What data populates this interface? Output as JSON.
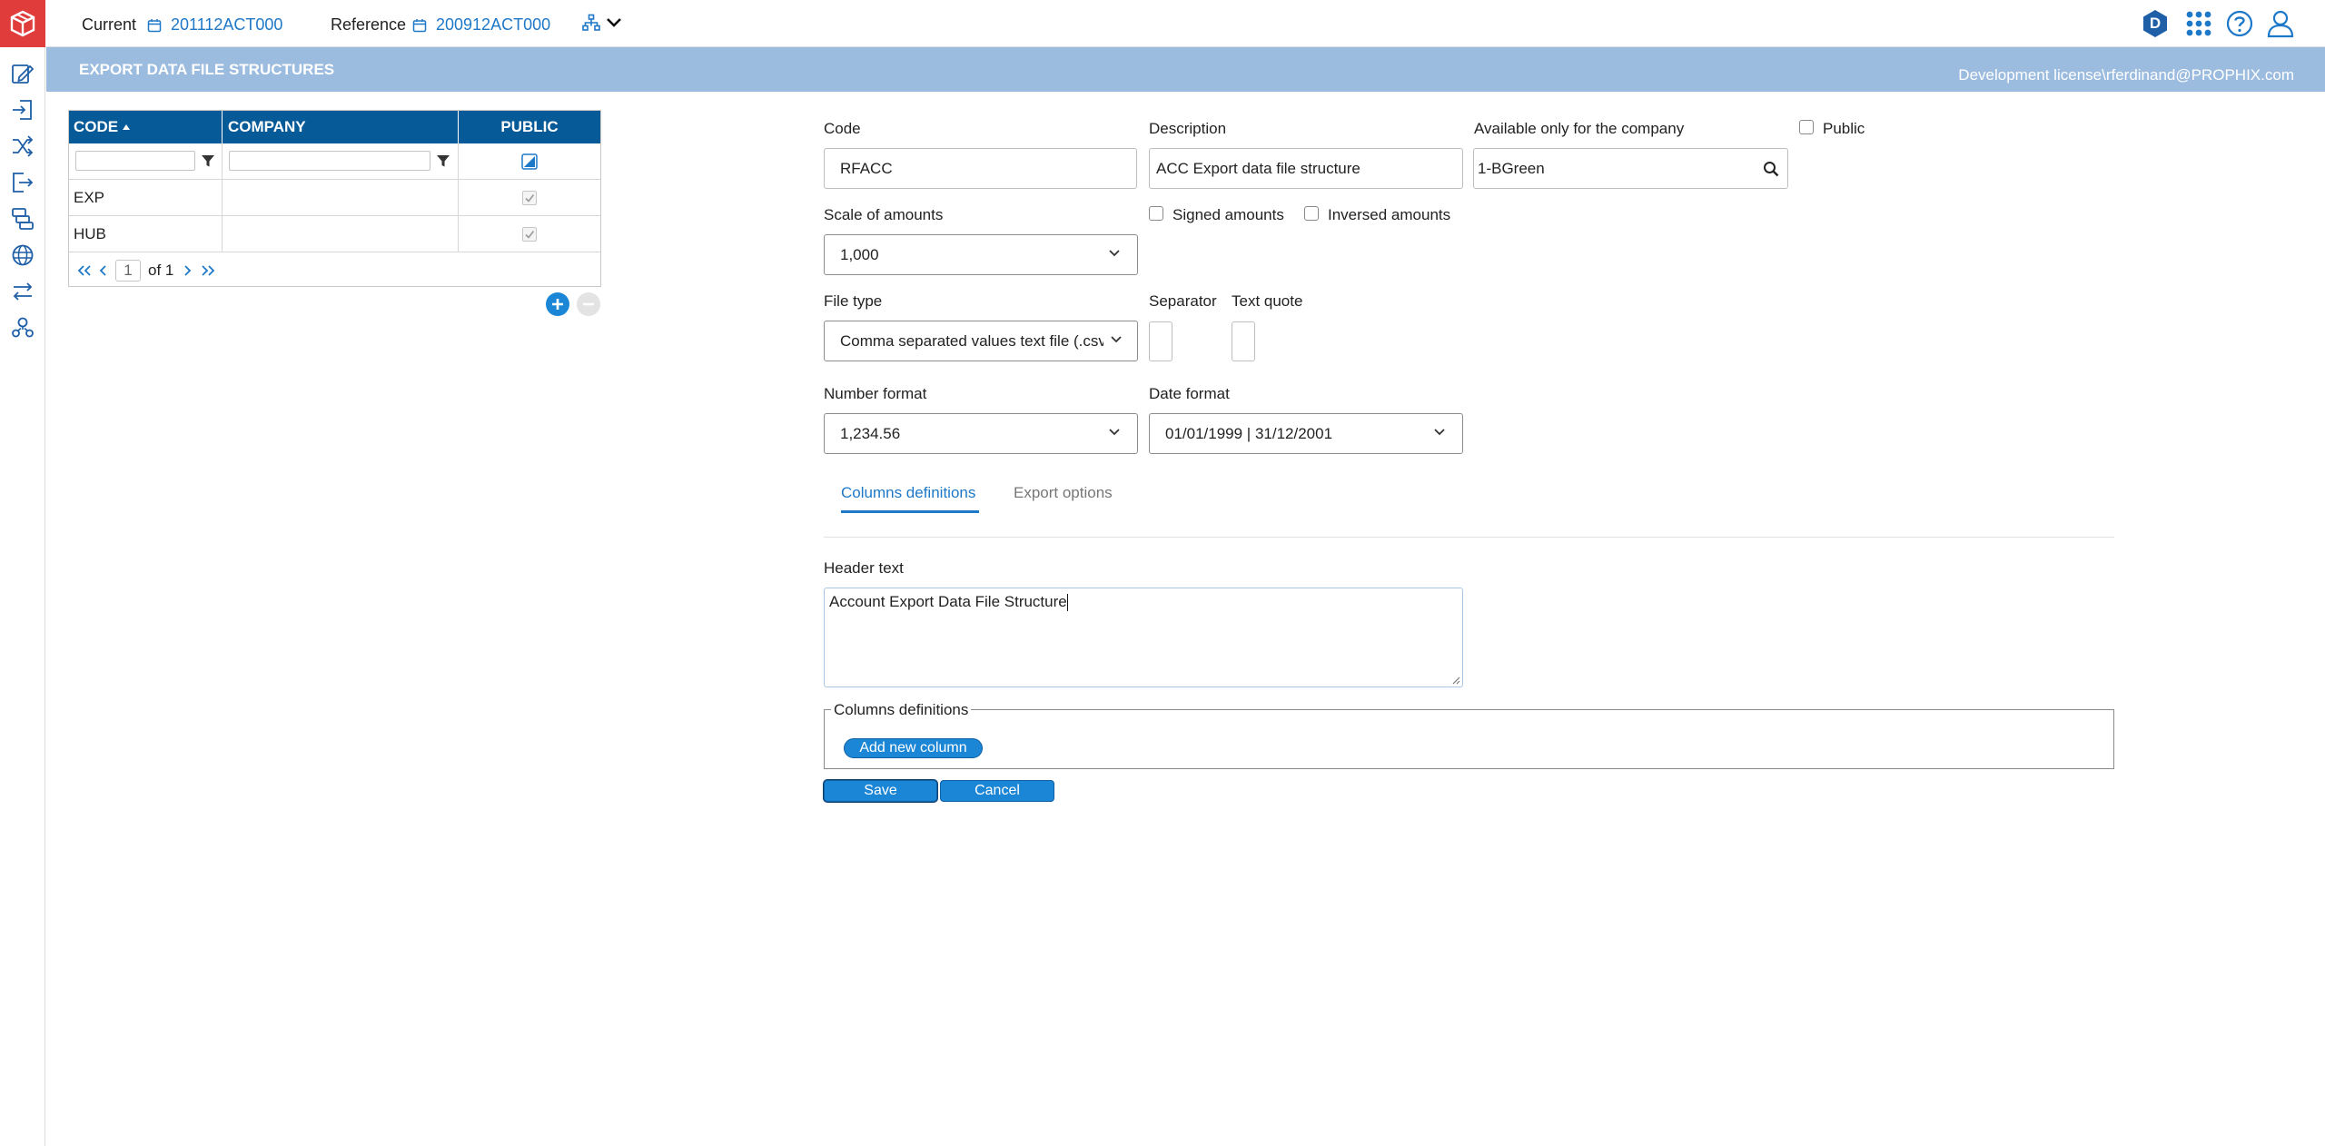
{
  "topbar": {
    "current_label": "Current",
    "current_value": "201112ACT000",
    "reference_label": "Reference",
    "reference_value": "200912ACT000",
    "avatar_letter": "D",
    "icons": [
      "app-logo-icon",
      "calendar-icon",
      "hierarchy-icon",
      "chevron-down-icon",
      "apps-grid-icon",
      "help-icon",
      "user-icon"
    ]
  },
  "sidebar": {
    "icons": [
      "edit-form-icon",
      "import-icon",
      "shuffle-icon",
      "export-icon",
      "layers-icon",
      "globe-icon",
      "transfer-icon",
      "org-chart-icon"
    ]
  },
  "titlebar": {
    "title": "EXPORT DATA FILE STRUCTURES",
    "license": "Development license\\rferdinand@PROPHIX.com"
  },
  "grid": {
    "columns": [
      "CODE",
      "COMPANY",
      "PUBLIC"
    ],
    "rows": [
      {
        "code": "EXP",
        "company": "",
        "public": true
      },
      {
        "code": "HUB",
        "company": "",
        "public": true
      }
    ],
    "pager": {
      "page": "1",
      "of_text": "of 1"
    }
  },
  "form": {
    "code_label": "Code",
    "code_value": "RFACC",
    "description_label": "Description",
    "description_value": "ACC Export data file structure",
    "company_label": "Available only for the company",
    "company_value": "1-BGreen",
    "public_label": "Public",
    "scale_label": "Scale of amounts",
    "scale_value": "1,000",
    "signed_label": "Signed amounts",
    "inversed_label": "Inversed amounts",
    "file_type_label": "File type",
    "file_type_value": "Comma separated values text file (.csv",
    "separator_label": "Separator",
    "text_quote_label": "Text quote",
    "number_format_label": "Number format",
    "number_format_value": "1,234.56",
    "date_format_label": "Date format",
    "date_format_value": "01/01/1999 | 31/12/2001"
  },
  "tabs": {
    "columns_definitions": "Columns definitions",
    "export_options": "Export options"
  },
  "columns_tab": {
    "header_text_label": "Header text",
    "header_text_value": "Account Export Data File Structure",
    "fieldset_legend": "Columns definitions",
    "add_column_label": "Add new column"
  },
  "actions": {
    "save_label": "Save",
    "cancel_label": "Cancel"
  },
  "colors": {
    "accent": "#1e78c8",
    "grid_header": "#075a98",
    "title_band": "#9bbbdf",
    "logo_bg": "#e03c3c"
  }
}
